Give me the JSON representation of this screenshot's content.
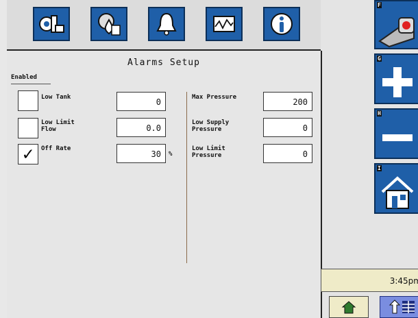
{
  "tabs": [
    {
      "icon": "machine-settings-icon"
    },
    {
      "icon": "product-settings-icon"
    },
    {
      "icon": "alarm-bell-icon"
    },
    {
      "icon": "monitor-graph-icon"
    },
    {
      "icon": "info-icon"
    }
  ],
  "page": {
    "title": "Alarms Setup",
    "enabled_label": "Enabled"
  },
  "left_rows": [
    {
      "label": "Low Tank",
      "value": "0",
      "checked": false,
      "unit": ""
    },
    {
      "label": "Low Limit\nFlow",
      "value": "0.0",
      "checked": false,
      "unit": ""
    },
    {
      "label": "Off Rate",
      "value": "30",
      "checked": true,
      "unit": "%"
    }
  ],
  "right_rows": [
    {
      "label": "Max Pressure",
      "value": "200"
    },
    {
      "label": "Low Supply\nPressure",
      "value": "0"
    },
    {
      "label": "Low Limit\nPressure",
      "value": "0"
    }
  ],
  "softkeys": [
    {
      "letter": "F",
      "icon": "camera-icon"
    },
    {
      "letter": "G",
      "icon": "plus-icon"
    },
    {
      "letter": "H",
      "icon": "minus-icon"
    },
    {
      "letter": "I",
      "icon": "home-icon"
    }
  ],
  "status": {
    "time": "3:45pm"
  },
  "colors": {
    "accent": "#1f5fa8",
    "clock_bg": "#efebc8",
    "menu_btn": "#7a8de0"
  }
}
